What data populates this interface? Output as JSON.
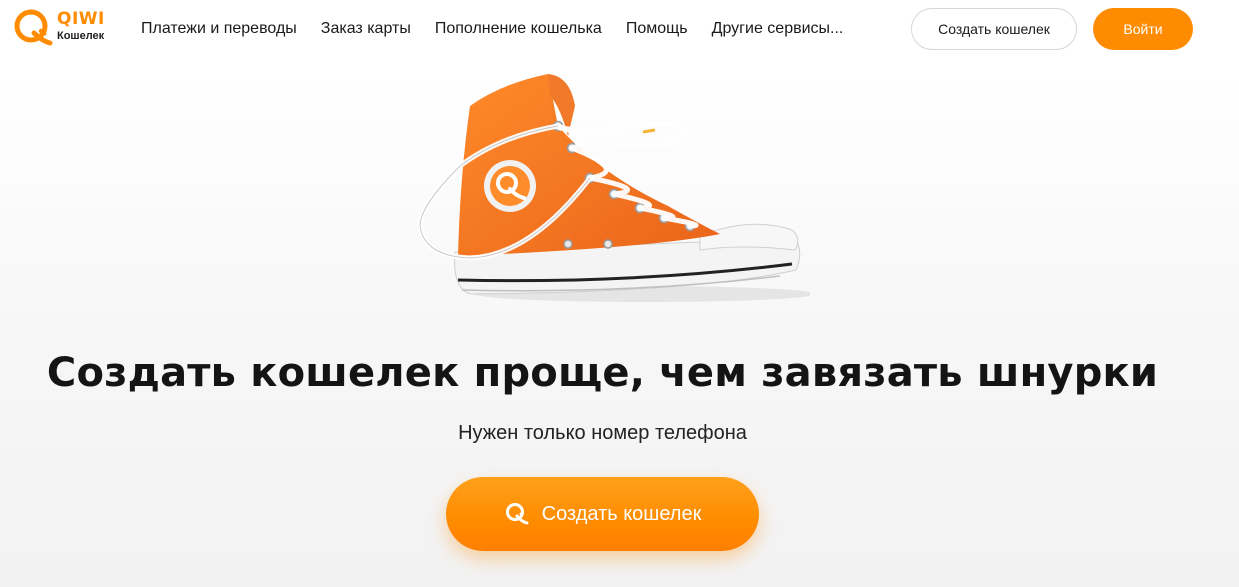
{
  "header": {
    "logo": {
      "brand": "QIWI",
      "subtitle": "Кошелек"
    },
    "nav": [
      {
        "label": "Платежи и переводы"
      },
      {
        "label": "Заказ карты"
      },
      {
        "label": "Пополнение кошелька"
      },
      {
        "label": "Помощь"
      },
      {
        "label": "Другие сервисы..."
      }
    ],
    "create_wallet_label": "Создать кошелек",
    "login_label": "Войти"
  },
  "hero": {
    "image": "orange-sneaker-with-untied-laces",
    "title": "Создать кошелек проще, чем завязать шнурки",
    "subtitle": "Нужен только номер телефона",
    "cta_label": "Создать кошелек",
    "cta_icon": "qiwi-logo-icon"
  },
  "colors": {
    "accent": "#ff8c00",
    "text": "#141414",
    "button_border": "#d6d6d6"
  }
}
